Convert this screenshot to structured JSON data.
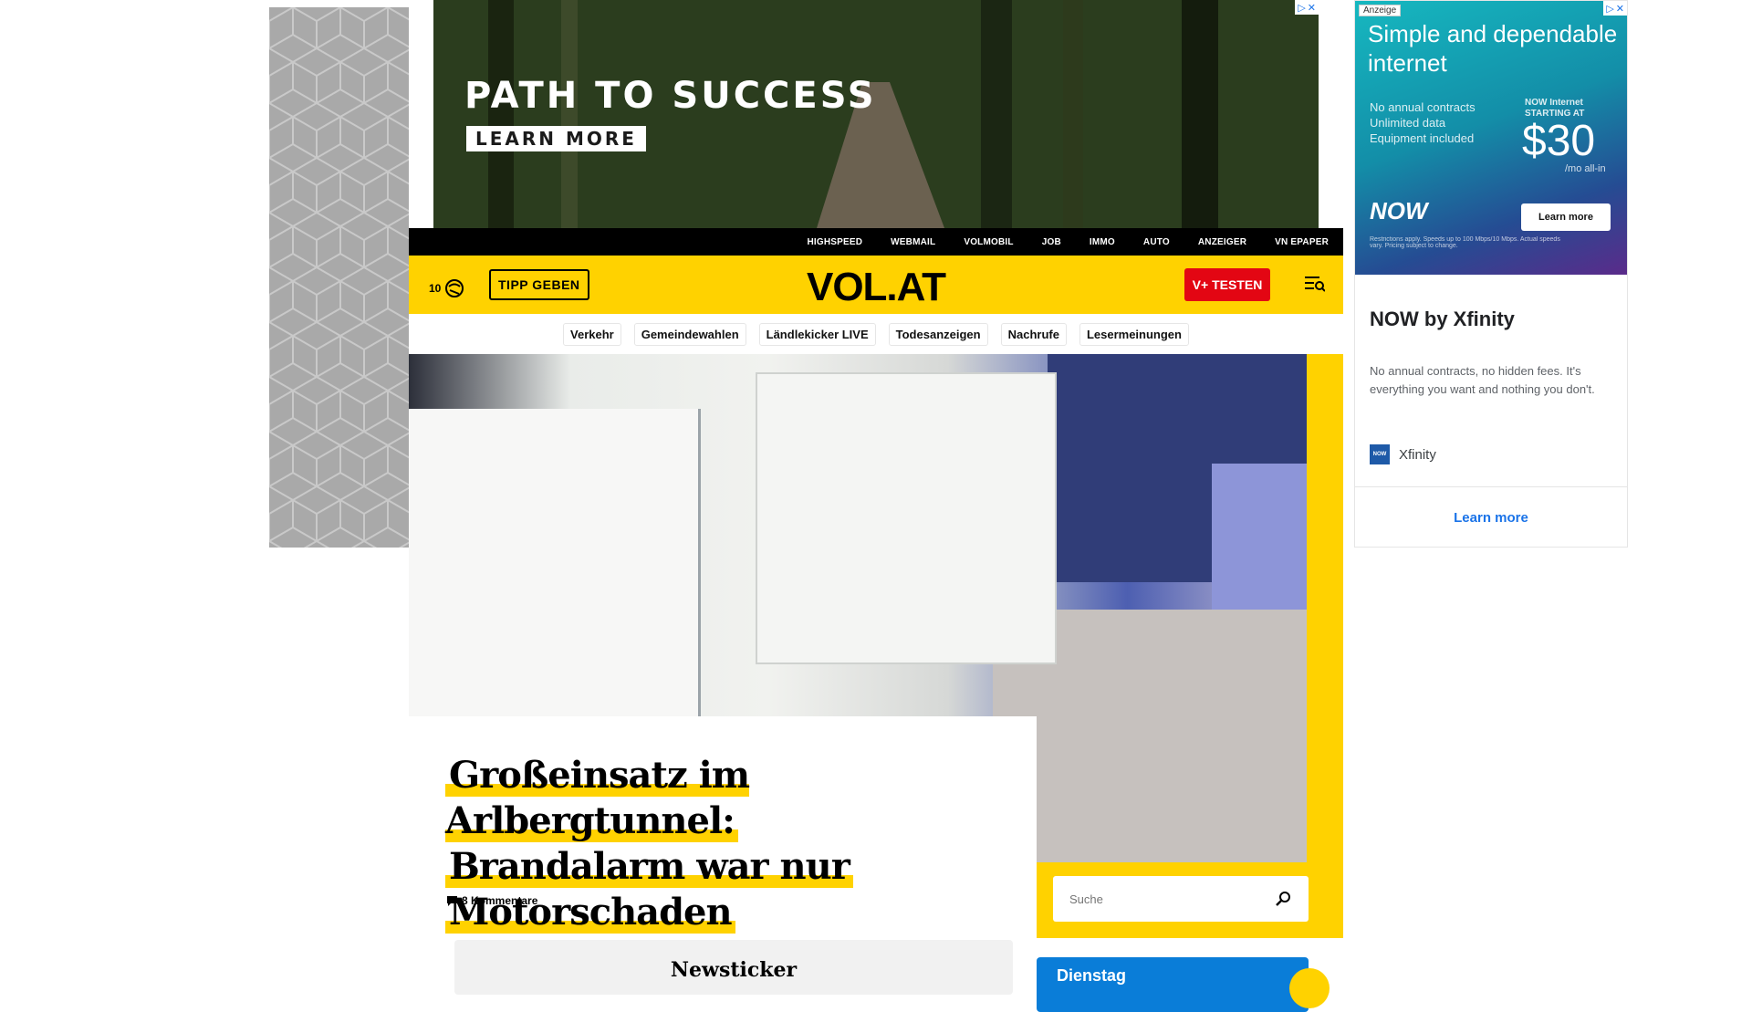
{
  "top_ad": {
    "title": "PATH TO SUCCESS",
    "button": "LEARN MORE"
  },
  "topnav": [
    "HIGHSPEED",
    "WEBMAIL",
    "VOLMOBIL",
    "JOB",
    "IMMO",
    "AUTO",
    "ANZEIGER",
    "VN EPAPER"
  ],
  "header": {
    "weather_count": "10",
    "tipp_label": "TIPP GEBEN",
    "logo": "VOL.AT",
    "vplus_label": "V+ TESTEN"
  },
  "categories": [
    "Verkehr",
    "Gemeindewahlen",
    "Ländlekicker LIVE",
    "Todesanzeigen",
    "Nachrufe",
    "Lesermeinungen"
  ],
  "article": {
    "headline_line1": "Großeinsatz im Arlbergtunnel:",
    "headline_line2": "Brandalarm war nur",
    "headline_line3": "Motorschaden",
    "comments": "8 Kommentare"
  },
  "newsticker": "Newsticker",
  "search": {
    "placeholder": "Suche"
  },
  "day_card": "Dienstag",
  "right_ad": {
    "tag": "Anzeige",
    "headline": "Simple and dependable internet",
    "features": [
      "No annual contracts",
      "Unlimited data",
      "Equipment included"
    ],
    "price_label_1": "NOW Internet",
    "price_label_2": "STARTING AT",
    "price": "$30",
    "price_period": "/mo all-in",
    "brand_logo": "NOW",
    "visual_cta": "Learn more",
    "fine_print": "Restrictions apply. Speeds up to 100 Mbps/10 Mbps. Actual speeds vary. Pricing subject to change.",
    "name": "NOW by Xfinity",
    "description": "No annual contracts, no hidden fees. It's everything you want and nothing you don't.",
    "advertiser": "Xfinity",
    "cta": "Learn more"
  },
  "colors": {
    "brand_yellow": "#ffd200",
    "vplus_red": "#e30613",
    "link_blue": "#1a73e8"
  }
}
